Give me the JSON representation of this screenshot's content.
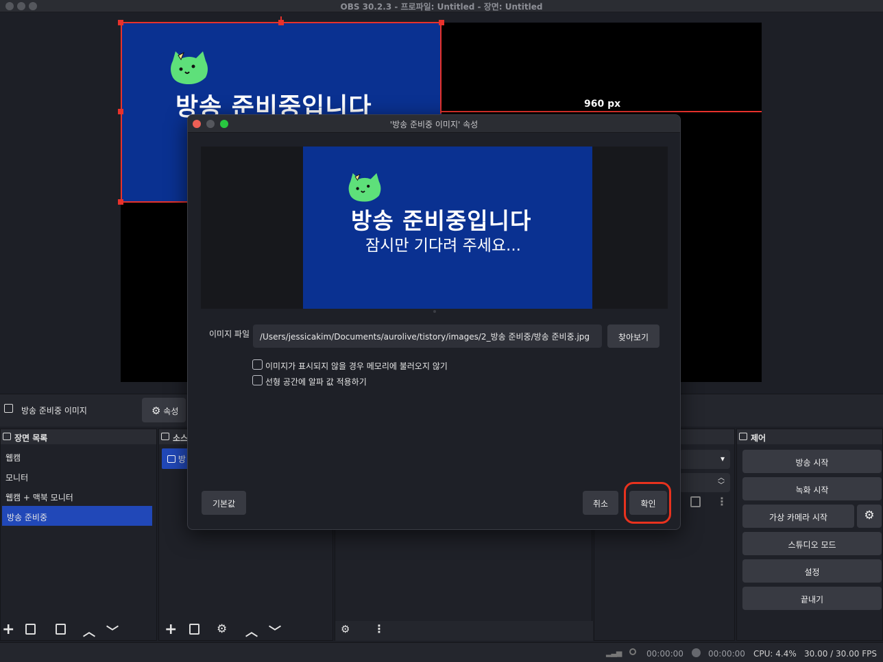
{
  "window": {
    "title": "OBS 30.2.3 - 프로파일: Untitled - 장면: Untitled"
  },
  "preview": {
    "source_title": "방송 준비중입니다",
    "dimension_label": "960 px"
  },
  "source_bar": {
    "source_name": "방송 준비중 이미지",
    "properties_label": "속성"
  },
  "scenes": {
    "header": "장면 목록",
    "items": [
      {
        "label": "웹캠"
      },
      {
        "label": "모니터"
      },
      {
        "label": "웹캠 + 맥북 모니터"
      },
      {
        "label": "방송 준비중"
      }
    ],
    "selected": "방송 준비중"
  },
  "sources": {
    "header": "소스",
    "item_label": "방"
  },
  "controls": {
    "header": "제어",
    "start_stream": "방송 시작",
    "start_record": "녹화 시작",
    "virtual_camera": "가상 카메라 시작",
    "studio_mode": "스튜디오 모드",
    "settings": "설정",
    "exit": "끝내기"
  },
  "status": {
    "stream_time": "00:00:00",
    "record_time": "00:00:00",
    "cpu": "CPU: 4.4%",
    "fps": "30.00 / 30.00 FPS"
  },
  "dialog": {
    "title": "'방송 준비중 이미지' 속성",
    "preview_title": "방송 준비중입니다",
    "preview_subtitle": "잠시만 기다려 주세요...",
    "image_file_label": "이미지 파일",
    "image_file_value": "/Users/jessicakim/Documents/aurolive/tistory/images/2_방송 준비중/방송 준비중.jpg",
    "browse_label": "찾아보기",
    "option1": "이미지가 표시되지 않을 경우 메모리에 불러오지 않기",
    "option2": "선형 공간에 알파 값 적용하기",
    "defaults_label": "기본값",
    "cancel_label": "취소",
    "ok_label": "확인"
  },
  "colors": {
    "accent": "#2148b8",
    "selection": "#e8322c",
    "image_bg": "#0a3191",
    "highlight_ring": "#e8321e"
  }
}
